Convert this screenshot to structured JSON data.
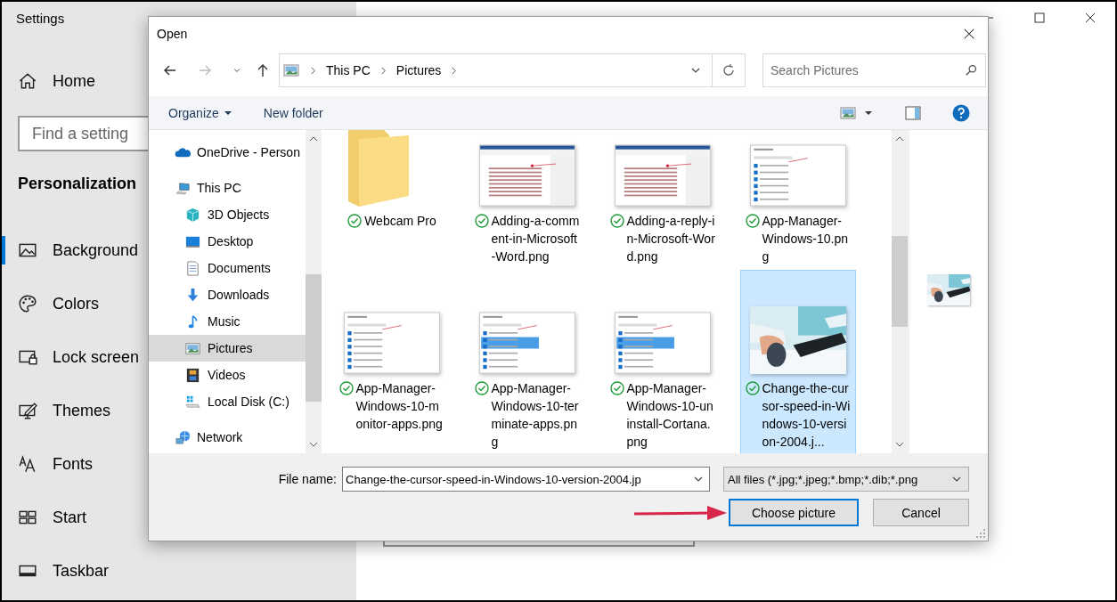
{
  "settings": {
    "title": "Settings",
    "home": "Home",
    "search": {
      "placeholder": "Find a setting"
    },
    "section": "Personalization",
    "items": [
      {
        "label": "Background",
        "selected": true
      },
      {
        "label": "Colors",
        "selected": false
      },
      {
        "label": "Lock screen",
        "selected": false
      },
      {
        "label": "Themes",
        "selected": false
      },
      {
        "label": "Fonts",
        "selected": false
      },
      {
        "label": "Start",
        "selected": false
      },
      {
        "label": "Taskbar",
        "selected": false
      }
    ]
  },
  "dialog": {
    "title": "Open",
    "nav_buttons": [
      {
        "kind": "back",
        "disabled": false
      },
      {
        "kind": "forward",
        "disabled": true
      },
      {
        "kind": "recent",
        "disabled": false
      },
      {
        "kind": "up",
        "disabled": false
      }
    ],
    "breadcrumb": [
      "This PC",
      "Pictures"
    ],
    "search": {
      "placeholder": "Search Pictures"
    },
    "toolbar": [
      {
        "label": "Organize",
        "menu": true
      },
      {
        "label": "New folder",
        "menu": false
      }
    ],
    "tree": [
      {
        "label": "OneDrive - Person",
        "selected": false
      },
      {
        "label": "This PC",
        "selected": false,
        "children": [
          {
            "label": "3D Objects",
            "selected": false
          },
          {
            "label": "Desktop",
            "selected": false
          },
          {
            "label": "Documents",
            "selected": false
          },
          {
            "label": "Downloads",
            "selected": false
          },
          {
            "label": "Music",
            "selected": false
          },
          {
            "label": "Pictures",
            "selected": true
          },
          {
            "label": "Videos",
            "selected": false
          },
          {
            "label": "Local Disk (C:)",
            "selected": false
          }
        ]
      },
      {
        "label": "Network",
        "selected": false
      }
    ],
    "files": [
      {
        "name": "Webcam Pro",
        "kind": "folder",
        "selected": false
      },
      {
        "name": "Adding-a-comment-in-Microsoft-Word.png",
        "kind": "screenshot",
        "selected": false
      },
      {
        "name": "Adding-a-reply-in-Microsoft-Word.png",
        "kind": "screenshot",
        "selected": false
      },
      {
        "name": "App-Manager-Windows-10.png",
        "kind": "screenshot",
        "selected": false
      },
      {
        "name": "App-Manager-Windows-10-monitor-apps.png",
        "kind": "screenshot",
        "selected": false
      },
      {
        "name": "App-Manager-Windows-10-terminate-apps.png",
        "kind": "screenshot",
        "selected": false
      },
      {
        "name": "App-Manager-Windows-10-uninstall-Cortana.png",
        "kind": "screenshot",
        "selected": false
      },
      {
        "name": "Change-the-cursor-speed-in-Windows-10-version-2004.j...",
        "selected": true
      }
    ],
    "file_name": {
      "label": "File name:",
      "value": "Change-the-cursor-speed-in-Windows-10-version-2004.jp"
    },
    "filter": "All files (*.jpg;*.jpeg;*.bmp;*.dib;*.png",
    "buttons": [
      {
        "label": "Choose picture",
        "default": true
      },
      {
        "label": "Cancel",
        "default": false
      }
    ]
  }
}
